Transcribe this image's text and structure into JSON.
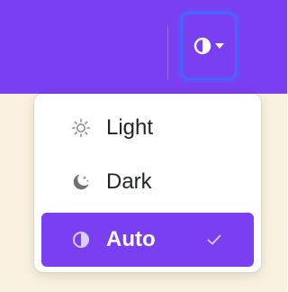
{
  "colors": {
    "accent": "#7a3ff0",
    "focus_ring": "#4a63ff",
    "page_background": "#f9f2de",
    "menu_background": "#ffffff",
    "text": "#212529"
  },
  "toggle": {
    "icon": "circle-half-icon",
    "caret": "caret-down-icon"
  },
  "theme_menu": {
    "items": [
      {
        "label": "Light",
        "icon": "sun-icon",
        "active": false
      },
      {
        "label": "Dark",
        "icon": "moon-stars-icon",
        "active": false
      },
      {
        "label": "Auto",
        "icon": "circle-half-icon",
        "active": true,
        "checked_icon": "check-icon"
      }
    ]
  }
}
